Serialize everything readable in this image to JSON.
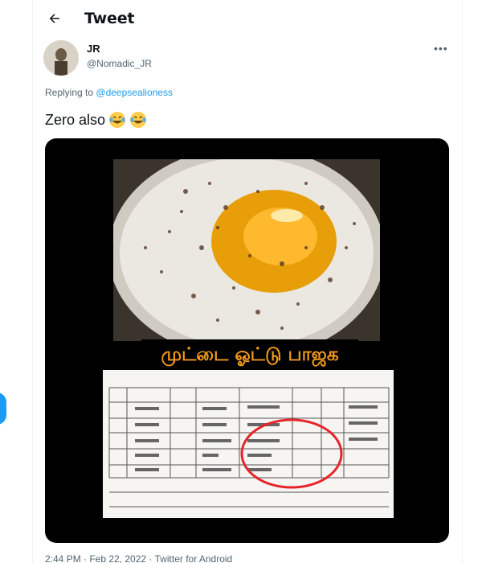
{
  "header": {
    "title": "Tweet"
  },
  "tweet": {
    "author_name": "JR",
    "author_handle": "@Nomadic_JR",
    "more_glyph": "•••",
    "replying_prefix": "Replying to",
    "replying_to": "@deepsealioness",
    "text": "Zero also",
    "emojis": [
      "face-with-tears-of-joy-icon",
      "face-with-tears-of-joy-icon"
    ],
    "image_caption": "முட்டை ஓட்டு பாஜக",
    "timestamp": "2:44 PM · Feb 22, 2022 · Twitter for Android"
  },
  "colors": {
    "accent": "#1d9bf0",
    "caption": "#f29a1b",
    "text": "#0f1419",
    "muted": "#536471"
  }
}
